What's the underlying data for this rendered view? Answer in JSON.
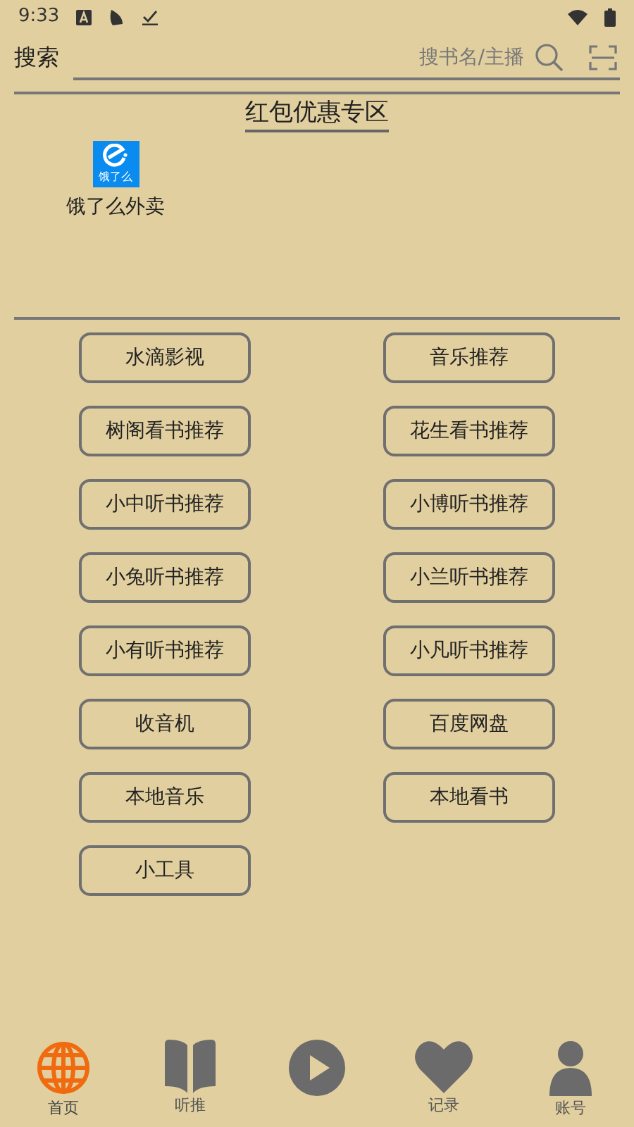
{
  "status_bar": {
    "time": "9:33"
  },
  "search": {
    "label": "搜索",
    "placeholder": "搜书名/主播"
  },
  "promo": {
    "title": "红包优惠专区",
    "apps": [
      {
        "icon_text": "饿了么",
        "label": "饿了么外卖"
      }
    ]
  },
  "buttons": [
    "水滴影视",
    "音乐推荐",
    "树阁看书推荐",
    "花生看书推荐",
    "小中听书推荐",
    "小博听书推荐",
    "小兔听书推荐",
    "小兰听书推荐",
    "小有听书推荐",
    "小凡听书推荐",
    "收音机",
    "百度网盘",
    "本地音乐",
    "本地看书",
    "小工具"
  ],
  "nav": [
    {
      "kind": "globe",
      "label": "首页",
      "selected": true
    },
    {
      "kind": "book",
      "label": "听推",
      "selected": false
    },
    {
      "kind": "play",
      "selected": false
    },
    {
      "kind": "heart",
      "label": "记录",
      "selected": false
    },
    {
      "kind": "person",
      "label": "账号",
      "selected": false
    }
  ]
}
